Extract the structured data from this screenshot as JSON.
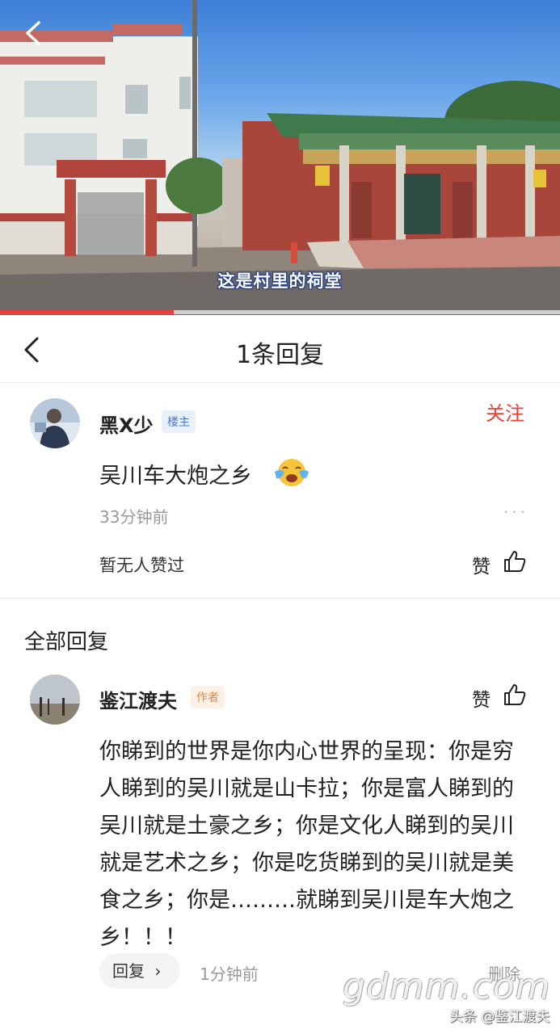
{
  "video": {
    "subtitle": "这是村里的祠堂",
    "progress": 0.31
  },
  "header": {
    "title": "1条回复"
  },
  "original_comment": {
    "username": "黑X少",
    "badge": "楼主",
    "follow_label": "关注",
    "text": "吴川车大炮之乡",
    "emoji": "loudly-crying-emoji",
    "time": "33分钟前",
    "more_label": "···",
    "no_likes": "暂无人赞过",
    "like_label": "赞"
  },
  "section_title": "全部回复",
  "reply": {
    "username": "鉴江渡夫",
    "badge": "作者",
    "like_label": "赞",
    "text": "你睇到的世界是你内心世界的呈现：你是穷人睇到的吴川就是山卡拉；你是富人睇到的吴川就是土豪之乡；你是文化人睇到的吴川就是艺术之乡；你是吃货睇到的吴川就是美食之乡；你是………就睇到吴川是车大炮之乡！！！",
    "reply_button": "回复",
    "time": "1分钟前",
    "delete_label": "删除"
  },
  "watermark": {
    "site": "gdmm.com",
    "author": "头条 @鉴江渡夫"
  },
  "colors": {
    "accent_red": "#ef3e35",
    "progress_red": "#e8403a",
    "host_badge_bg": "#e8f0fb",
    "host_badge_text": "#4a78c0",
    "author_badge_bg": "#fdf0e4",
    "author_badge_text": "#e2874a",
    "muted_text": "#9a9a9a"
  }
}
